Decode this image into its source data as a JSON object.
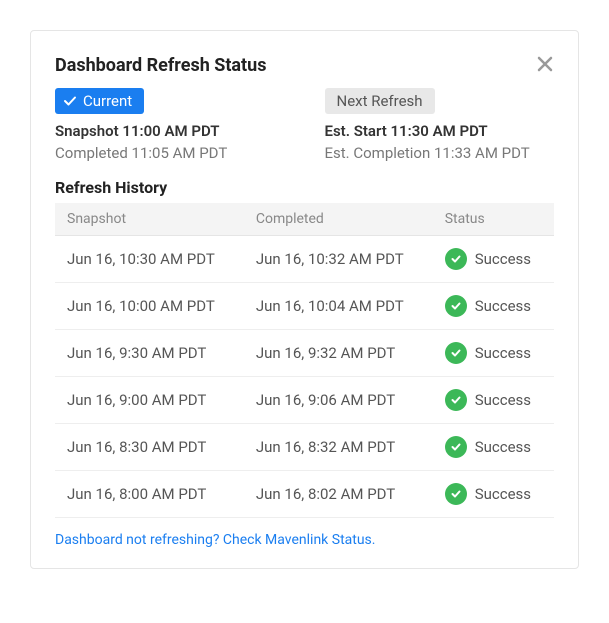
{
  "header": {
    "title": "Dashboard Refresh Status"
  },
  "current": {
    "badge_label": "Current",
    "line1": "Snapshot 11:00 AM PDT",
    "line2": "Completed 11:05 AM PDT"
  },
  "next": {
    "badge_label": "Next Refresh",
    "line1": "Est. Start 11:30 AM PDT",
    "line2": "Est. Completion 11:33 AM PDT"
  },
  "history": {
    "title": "Refresh History",
    "columns": {
      "snapshot": "Snapshot",
      "completed": "Completed",
      "status": "Status"
    },
    "rows": [
      {
        "snapshot": "Jun 16, 10:30 AM PDT",
        "completed": "Jun 16, 10:32 AM PDT",
        "status": "Success"
      },
      {
        "snapshot": "Jun 16, 10:00 AM PDT",
        "completed": "Jun 16, 10:04 AM PDT",
        "status": "Success"
      },
      {
        "snapshot": "Jun 16, 9:30 AM PDT",
        "completed": "Jun 16, 9:32 AM PDT",
        "status": "Success"
      },
      {
        "snapshot": "Jun 16, 9:00 AM PDT",
        "completed": "Jun 16, 9:06 AM PDT",
        "status": "Success"
      },
      {
        "snapshot": "Jun 16, 8:30 AM PDT",
        "completed": "Jun 16, 8:32 AM PDT",
        "status": "Success"
      },
      {
        "snapshot": "Jun 16, 8:00 AM PDT",
        "completed": "Jun 16, 8:02 AM PDT",
        "status": "Success"
      }
    ]
  },
  "footer": {
    "link_text": "Dashboard not refreshing? Check Mavenlink Status."
  }
}
